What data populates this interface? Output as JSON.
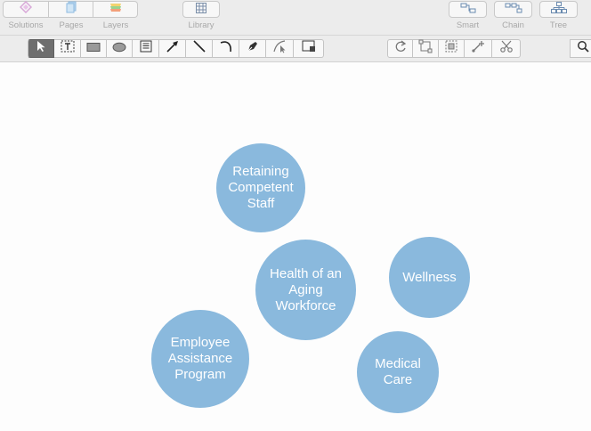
{
  "top_toolbar": {
    "left_group": [
      {
        "label": "Solutions",
        "icon": "solutions-icon"
      },
      {
        "label": "Pages",
        "icon": "pages-icon"
      },
      {
        "label": "Layers",
        "icon": "layers-icon"
      }
    ],
    "library": {
      "label": "Library",
      "icon": "library-icon"
    },
    "right_group": [
      {
        "label": "Smart",
        "icon": "smart-connector-icon"
      },
      {
        "label": "Chain",
        "icon": "chain-icon"
      },
      {
        "label": "Tree",
        "icon": "tree-icon"
      }
    ]
  },
  "drawing_tools": [
    {
      "name": "select",
      "icon": "arrow-pointer-icon",
      "active": true
    },
    {
      "name": "text",
      "icon": "text-box-icon"
    },
    {
      "name": "rectangle",
      "icon": "rectangle-icon"
    },
    {
      "name": "ellipse",
      "icon": "ellipse-icon"
    },
    {
      "name": "note",
      "icon": "note-icon"
    },
    {
      "name": "arrow",
      "icon": "arrow-line-icon"
    },
    {
      "name": "line",
      "icon": "line-icon"
    },
    {
      "name": "arc",
      "icon": "arc-icon"
    },
    {
      "name": "pen",
      "icon": "pen-icon"
    },
    {
      "name": "bezier",
      "icon": "bezier-icon"
    },
    {
      "name": "container",
      "icon": "container-icon"
    }
  ],
  "connector_tools": [
    {
      "name": "rotate",
      "icon": "rotate-icon"
    },
    {
      "name": "crop",
      "icon": "crop-icon"
    },
    {
      "name": "group",
      "icon": "group-icon"
    },
    {
      "name": "add-point",
      "icon": "add-point-icon"
    },
    {
      "name": "scissors",
      "icon": "scissors-icon"
    }
  ],
  "search": {
    "icon": "search-icon"
  },
  "colors": {
    "bubble_fill": "#8ab9dd",
    "bubble_text": "#ffffff"
  },
  "diagram": {
    "bubbles": [
      {
        "id": "retaining",
        "text": "Retaining\nCompetent\nStaff"
      },
      {
        "id": "health",
        "text": "Health of an\nAging\nWorkforce"
      },
      {
        "id": "wellness",
        "text": "Wellness"
      },
      {
        "id": "employee",
        "text": "Employee\nAssistance\nProgram"
      },
      {
        "id": "medical",
        "text": "Medical\nCare"
      }
    ]
  }
}
